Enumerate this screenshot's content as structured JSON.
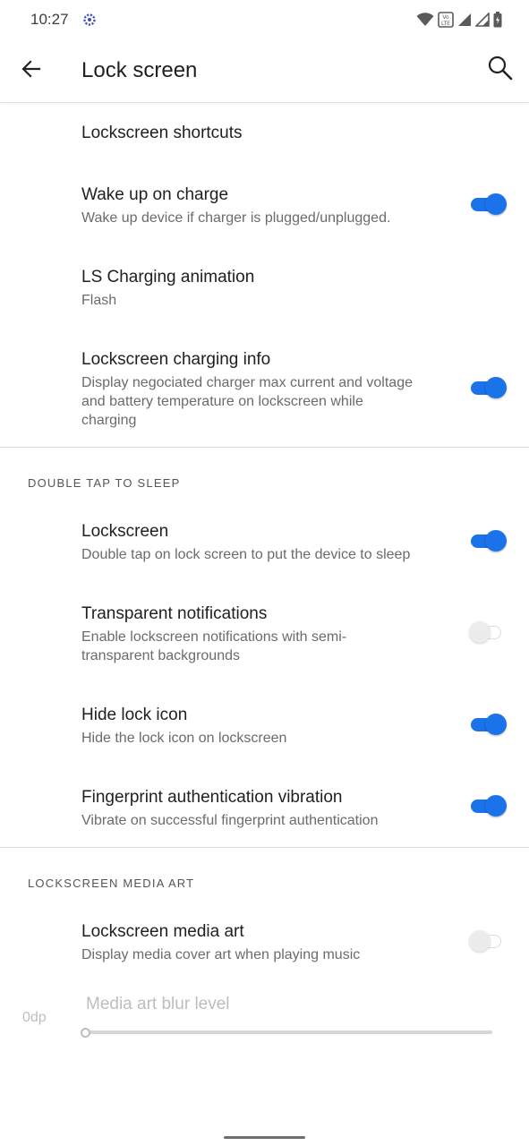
{
  "status_bar": {
    "time": "10:27",
    "notification_icon": "settings-gear-icon",
    "right_icons": [
      "wifi-icon",
      "volte-icon",
      "signal-icon",
      "signal-icon-2",
      "battery-icon"
    ]
  },
  "app_bar": {
    "title": "Lock screen",
    "back_icon": "arrow-back-icon",
    "search_icon": "search-icon"
  },
  "colors": {
    "accent": "#1a73e8",
    "text_primary": "#1f1f1f",
    "text_secondary": "#6b6b6b",
    "disabled": "#bdbdbd"
  },
  "prefs": {
    "shortcuts": {
      "title": "Lockscreen shortcuts"
    },
    "wake_on_charge": {
      "title": "Wake up on charge",
      "summary": "Wake up device if charger is plugged/unplugged.",
      "checked": true
    },
    "charging_anim": {
      "title": "LS Charging animation",
      "summary": "Flash"
    },
    "charging_info": {
      "title": "Lockscreen charging info",
      "summary": "Display negociated charger max current and voltage and battery temperature on lockscreen while charging",
      "checked": true
    }
  },
  "double_tap": {
    "header": "DOUBLE TAP TO SLEEP",
    "lockscreen": {
      "title": "Lockscreen",
      "summary": "Double tap on lock screen to put the device to sleep",
      "checked": true
    },
    "transparent": {
      "title": "Transparent notifications",
      "summary": "Enable lockscreen notifications with semi-transparent backgrounds",
      "checked": false
    },
    "hide_lock": {
      "title": "Hide lock icon",
      "summary": "Hide the lock icon on lockscreen",
      "checked": true
    },
    "fp_vibration": {
      "title": "Fingerprint authentication vibration",
      "summary": "Vibrate on successful fingerprint authentication",
      "checked": true
    }
  },
  "media_art": {
    "header": "LOCKSCREEN MEDIA ART",
    "toggle": {
      "title": "Lockscreen media art",
      "summary": "Display media cover art when playing music",
      "checked": false
    },
    "blur": {
      "title": "Media art blur level",
      "value_label": "0dp",
      "value": 0
    }
  }
}
